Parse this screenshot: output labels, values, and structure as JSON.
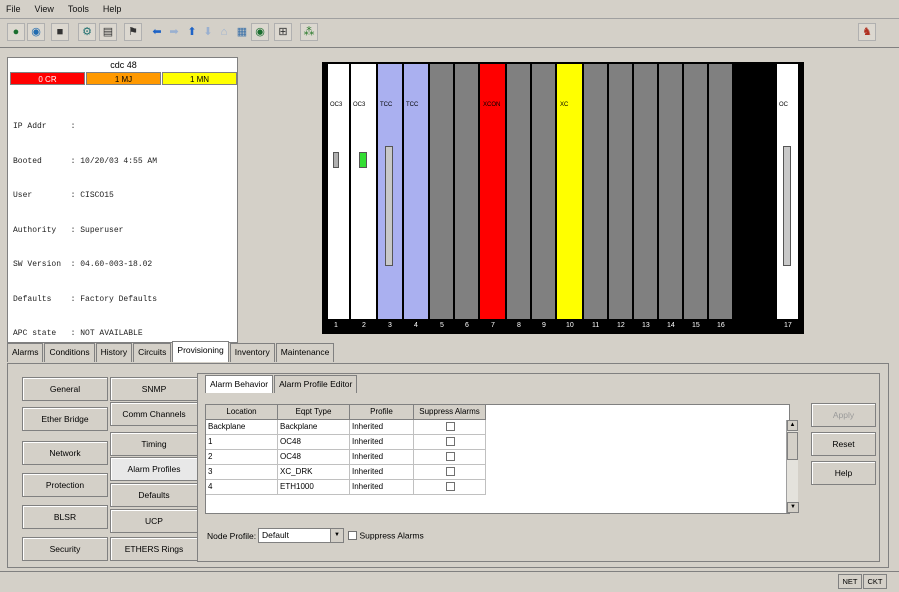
{
  "menu": [
    "File",
    "View",
    "Tools",
    "Help"
  ],
  "toolbar_icons": [
    "globe-icon",
    "network-icon",
    "lock-icon",
    "link-icon",
    "save-icon",
    "flag-icon",
    "back-arrow-icon",
    "forward-arrow-icon",
    "up-arrow-icon",
    "down-arrow-icon",
    "home-icon",
    "map-icon",
    "refresh-icon",
    "add-node-icon",
    "tree-icon"
  ],
  "summary": {
    "node_name": "cdc 48",
    "alarms": [
      {
        "label": "0 CR",
        "color": "#ff0000",
        "text_color": "#ffffff"
      },
      {
        "label": "1 MJ",
        "color": "#ff9900",
        "text_color": "#000000"
      },
      {
        "label": "1 MN",
        "color": "#ffff00",
        "text_color": "#000000"
      }
    ],
    "info_lines": [
      "IP Addr     : ",
      "Booted      : 10/20/03 4:55 AM",
      "User        : CISCO15",
      "Authority   : Superuser",
      "SW Version  : 04.60-003-18.02",
      "Defaults    : Factory Defaults",
      "APC state   : NOT AVAILABLE"
    ]
  },
  "shelf": {
    "slot_numbers": [
      "1",
      "2",
      "3",
      "4",
      "5",
      "6",
      "7",
      "8",
      "9",
      "10",
      "11",
      "12",
      "13",
      "14",
      "15",
      "16",
      "17"
    ],
    "cards": [
      {
        "color": "#ffffff",
        "label": "OC3"
      },
      {
        "color": "#ffffff",
        "label": "OC3"
      },
      {
        "color": "#aab0f0",
        "label": "TCC"
      },
      {
        "color": "#aab0f0",
        "label": "TCC"
      },
      {
        "color": "#808080",
        "label": ""
      },
      {
        "color": "#808080",
        "label": ""
      },
      {
        "color": "#ff0000",
        "label": "XCON"
      },
      {
        "color": "#808080",
        "label": ""
      },
      {
        "color": "#808080",
        "label": ""
      },
      {
        "color": "#ffff00",
        "label": "XC"
      },
      {
        "color": "#808080",
        "label": ""
      },
      {
        "color": "#808080",
        "label": ""
      },
      {
        "color": "#808080",
        "label": ""
      },
      {
        "color": "#808080",
        "label": ""
      },
      {
        "color": "#808080",
        "label": ""
      },
      {
        "color": "#808080",
        "label": ""
      },
      {
        "color": "#ffffff",
        "label": "OC"
      }
    ]
  },
  "tabs": [
    "Alarms",
    "Conditions",
    "History",
    "Circuits",
    "Provisioning",
    "Inventory",
    "Maintenance"
  ],
  "active_tab": 4,
  "left_buttons_col1": [
    "General",
    "Ether Bridge",
    "Network",
    "Protection",
    "BLSR",
    "Security"
  ],
  "left_buttons_col2": [
    "SNMP",
    "Comm Channels",
    "Timing",
    "Alarm Profiles",
    "Defaults",
    "UCP",
    "ETHERS Rings"
  ],
  "sub_tabs": [
    "Alarm Behavior",
    "Alarm Profile Editor"
  ],
  "table": {
    "columns": [
      "Location",
      "Eqpt Type",
      "Profile",
      "Suppress Alarms"
    ],
    "rows": [
      [
        "Backplane",
        "Backplane",
        "Inherited",
        ""
      ],
      [
        "1",
        "OC48",
        "Inherited",
        ""
      ],
      [
        "2",
        "OC48",
        "Inherited",
        ""
      ],
      [
        "3",
        "XC_DRK",
        "Inherited",
        ""
      ],
      [
        "4",
        "ETH1000",
        "Inherited",
        ""
      ]
    ]
  },
  "node_profile_label": "Node Profile:",
  "node_profile_value": "Default",
  "suppress_alarms_label": "Suppress Alarms",
  "right_buttons": [
    "Apply",
    "Reset",
    "Help"
  ],
  "status": {
    "net": "NET",
    "ckt": "CKT"
  }
}
